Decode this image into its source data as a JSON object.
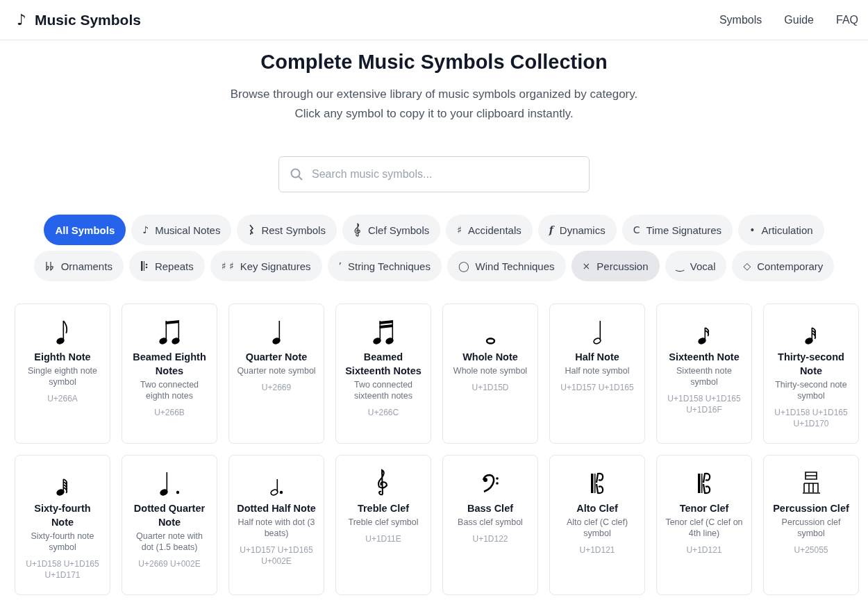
{
  "header": {
    "logo": "♪",
    "brand": "Music Symbols",
    "nav": [
      {
        "label": "Symbols"
      },
      {
        "label": "Guide"
      },
      {
        "label": "FAQ"
      }
    ]
  },
  "hero": {
    "title": "Complete Music Symbols Collection",
    "subtitle": [
      "Browse through our extensive library of music symbols organized by category.",
      "Click any symbol to copy it to your clipboard instantly."
    ]
  },
  "search": {
    "placeholder": "Search music symbols..."
  },
  "filters": [
    {
      "label": "All Symbols",
      "selected": true,
      "hovered": false,
      "kind": "plain"
    },
    {
      "label": "Musical Notes",
      "selected": false,
      "hovered": false,
      "symbol": "♪"
    },
    {
      "label": "Rest Symbols",
      "selected": false,
      "hovered": false,
      "kind": "rest"
    },
    {
      "label": "Clef Symbols",
      "selected": false,
      "hovered": false,
      "kind": "clef"
    },
    {
      "label": "Accidentals",
      "selected": false,
      "hovered": false,
      "symbol": "♯"
    },
    {
      "label": "Dynamics",
      "selected": false,
      "hovered": false,
      "symbol": "f",
      "kind": "dynamic"
    },
    {
      "label": "Time Signatures",
      "selected": false,
      "hovered": false,
      "symbol": "C"
    },
    {
      "label": "Articulation",
      "selected": false,
      "hovered": false,
      "symbol": "•"
    },
    {
      "label": "Ornaments",
      "selected": false,
      "hovered": false,
      "kind": "ornament"
    },
    {
      "label": "Repeats",
      "selected": false,
      "hovered": false,
      "kind": "repeat"
    },
    {
      "label": "Key Signatures",
      "selected": false,
      "hovered": false,
      "symbol": "♯ ♯"
    },
    {
      "label": "String Techniques",
      "selected": false,
      "hovered": false,
      "symbol": "’"
    },
    {
      "label": "Wind Techniques",
      "selected": false,
      "hovered": false,
      "symbol": "◯"
    },
    {
      "label": "Percussion",
      "selected": false,
      "hovered": true,
      "symbol": "×"
    },
    {
      "label": "Vocal",
      "selected": false,
      "hovered": false,
      "symbol": "‿"
    },
    {
      "label": "Contemporary",
      "selected": false,
      "hovered": false,
      "symbol": "◇"
    }
  ],
  "cards": [
    {
      "kind": "eighth",
      "name": "Eighth Note",
      "description": "Single eighth note symbol",
      "code": "U+266A"
    },
    {
      "kind": "beamed-eighth",
      "name": "Beamed Eighth Notes",
      "description": "Two connected eighth notes",
      "code": "U+266B"
    },
    {
      "kind": "quarter",
      "name": "Quarter Note",
      "description": "Quarter note symbol",
      "code": "U+2669"
    },
    {
      "kind": "beamed-sixteenth",
      "name": "Beamed Sixteenth Notes",
      "description": "Two connected sixteenth notes",
      "code": "U+266C"
    },
    {
      "kind": "whole",
      "name": "Whole Note",
      "description": "Whole note symbol",
      "code": "U+1D15D"
    },
    {
      "kind": "half",
      "name": "Half Note",
      "description": "Half note symbol",
      "code": "U+1D157 U+1D165"
    },
    {
      "kind": "sixteenth",
      "name": "Sixteenth Note",
      "description": "Sixteenth note symbol",
      "code": "U+1D158 U+1D165 U+1D16F"
    },
    {
      "kind": "thirty-second",
      "name": "Thirty-second Note",
      "description": "Thirty-second note symbol",
      "code": "U+1D158 U+1D165 U+1D170"
    },
    {
      "kind": "sixty-fourth",
      "name": "Sixty-fourth Note",
      "description": "Sixty-fourth note symbol",
      "code": "U+1D158 U+1D165 U+1D171"
    },
    {
      "kind": "dotted-quarter",
      "name": "Dotted Quarter Note",
      "description": "Quarter note with dot (1.5 beats)",
      "code": "U+2669 U+002E"
    },
    {
      "kind": "dotted-half",
      "name": "Dotted Half Note",
      "description": "Half note with dot (3 beats)",
      "code": "U+1D157 U+1D165 U+002E"
    },
    {
      "kind": "treble",
      "name": "Treble Clef",
      "description": "Treble clef symbol",
      "code": "U+1D11E"
    },
    {
      "kind": "bass",
      "name": "Bass Clef",
      "description": "Bass clef symbol",
      "code": "U+1D122"
    },
    {
      "kind": "alto",
      "name": "Alto Clef",
      "description": "Alto clef (C clef) symbol",
      "code": "U+1D121"
    },
    {
      "kind": "tenor",
      "name": "Tenor Clef",
      "description": "Tenor clef (C clef on 4th line)",
      "code": "U+1D121"
    },
    {
      "kind": "percussion",
      "name": "Percussion Clef",
      "description": "Percussion clef symbol",
      "code": "U+25055"
    }
  ]
}
